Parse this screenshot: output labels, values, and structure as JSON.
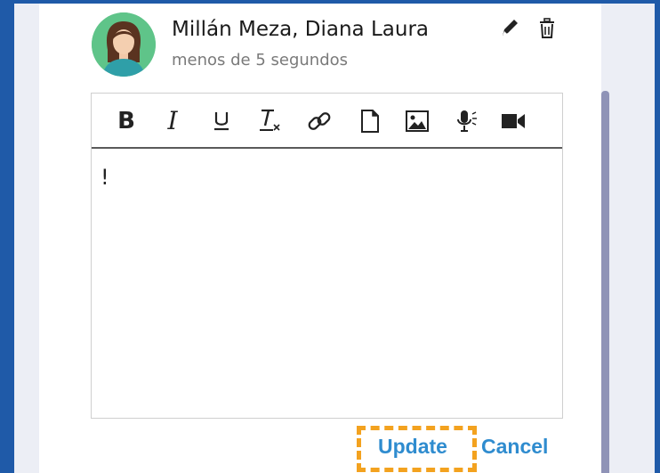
{
  "comment": {
    "author": "Millán Meza, Diana Laura",
    "timestamp": "menos de 5 segundos"
  },
  "icons": {
    "edit": "pencil-icon",
    "delete": "trash-icon",
    "bold": "B",
    "italic": "I"
  },
  "editor": {
    "content": "!"
  },
  "actions": {
    "update_label": "Update",
    "cancel_label": "Cancel"
  },
  "colors": {
    "accent_link": "#2f8ccf",
    "highlight": "#f3a21f",
    "frame": "#1f5aa8",
    "avatar_bg": "#5fc489"
  }
}
